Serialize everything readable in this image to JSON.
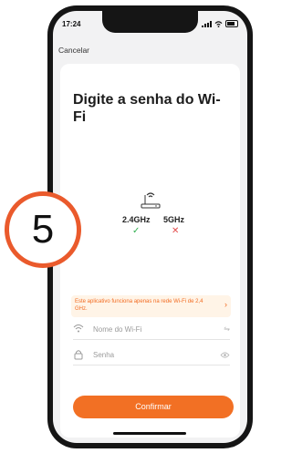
{
  "status": {
    "time": "17:24"
  },
  "nav": {
    "cancel": "Cancelar"
  },
  "title": "Digite a senha do Wi-Fi",
  "bands": [
    {
      "label": "2.4GHz",
      "supported": true,
      "symbol": "✓"
    },
    {
      "label": "5GHz",
      "supported": false,
      "symbol": "✕"
    }
  ],
  "banner": {
    "text": "Este aplicativo funciona apenas na rede Wi-Fi de 2,4 GHz.",
    "arrow": "›"
  },
  "wifi_field": {
    "placeholder": "Nome do Wi-Fi",
    "action": "⇋"
  },
  "password_field": {
    "placeholder": "Senha"
  },
  "confirm_label": "Confirmar",
  "step_badge": "5",
  "colors": {
    "accent": "#f27024",
    "badge_ring": "#ea5a2c",
    "check": "#30b04f",
    "cross": "#e34a4a"
  },
  "icons": [
    "router-icon",
    "wifi-icon",
    "lock-icon",
    "swap-icon",
    "eye-icon",
    "chevron-right-icon",
    "check-icon",
    "cross-icon"
  ]
}
